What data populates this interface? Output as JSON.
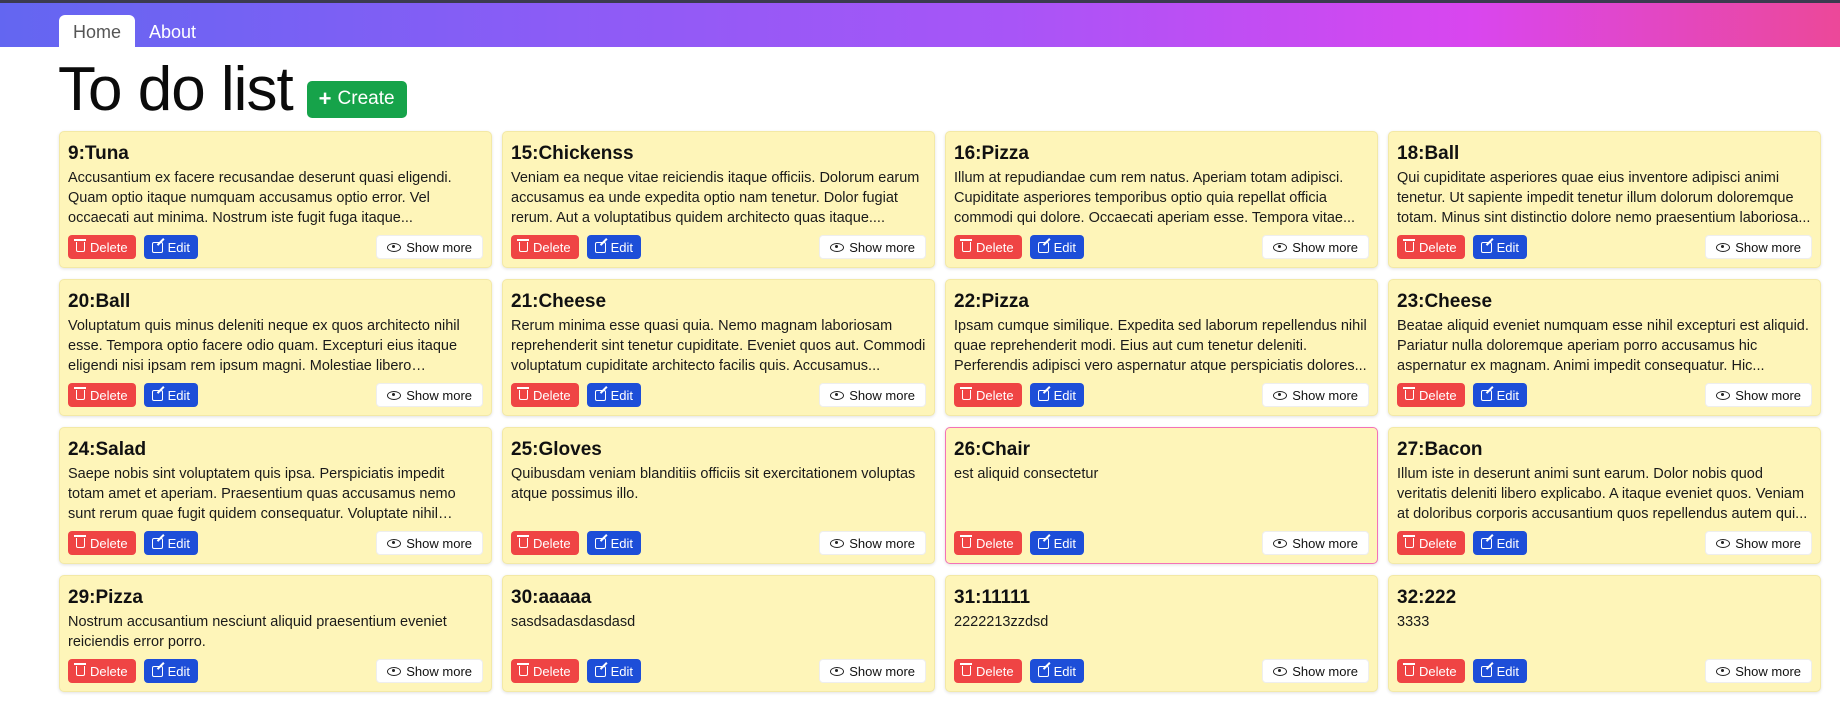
{
  "nav": {
    "tabs": [
      "Home",
      "About"
    ]
  },
  "header": {
    "title": "To do list",
    "create_label": "Create"
  },
  "actions": {
    "delete_label": "Delete",
    "edit_label": "Edit",
    "show_label": "Show more"
  },
  "cards": [
    {
      "title": "9:Tuna",
      "body": "Accusantium ex facere recusandae deserunt quasi eligendi. Quam optio itaque numquam accusamus optio error. Vel occaecati aut minima. Nostrum iste fugit fuga itaque..."
    },
    {
      "title": "15:Chickenss",
      "body": "Veniam ea neque vitae reiciendis itaque officiis. Dolorum earum accusamus ea unde expedita optio nam tenetur. Dolor fugiat rerum. Aut a voluptatibus quidem architecto quas itaque...."
    },
    {
      "title": "16:Pizza",
      "body": "Illum at repudiandae cum rem natus. Aperiam totam adipisci. Cupiditate asperiores temporibus optio quia repellat officia commodi qui dolore. Occaecati aperiam esse. Tempora vitae..."
    },
    {
      "title": "18:Ball",
      "body": "Qui cupiditate asperiores quae eius inventore adipisci animi tenetur. Ut sapiente impedit tenetur illum dolorum doloremque totam. Minus sint distinctio dolore nemo praesentium laboriosa..."
    },
    {
      "title": "20:Ball",
      "body": "Voluptatum quis minus deleniti neque ex quos architecto nihil esse. Tempora optio facere odio quam. Excepturi eius itaque eligendi nisi ipsam rem ipsum magni. Molestiae libero deserunt..."
    },
    {
      "title": "21:Cheese",
      "body": "Rerum minima esse quasi quia. Nemo magnam laboriosam reprehenderit sint tenetur cupiditate. Eveniet quos aut. Commodi voluptatum cupiditate architecto facilis quis. Accusamus..."
    },
    {
      "title": "22:Pizza",
      "body": "Ipsam cumque similique. Expedita sed laborum repellendus nihil quae reprehenderit modi. Eius aut cum tenetur deleniti. Perferendis adipisci vero aspernatur atque perspiciatis dolores..."
    },
    {
      "title": "23:Cheese",
      "body": "Beatae aliquid eveniet numquam esse nihil excepturi est aliquid. Pariatur nulla doloremque aperiam porro accusamus hic aspernatur ex magnam. Animi impedit consequatur. Hic..."
    },
    {
      "title": "24:Salad",
      "body": "Saepe nobis sint voluptatem quis ipsa. Perspiciatis impedit totam amet et aperiam. Praesentium quas accusamus nemo sunt rerum quae fugit quidem consequatur. Voluptate nihil quisquam..."
    },
    {
      "title": "25:Gloves",
      "body": "Quibusdam veniam blanditiis officiis sit exercitationem voluptas atque possimus illo."
    },
    {
      "title": "26:Chair",
      "body": "est aliquid consectetur",
      "highlight": true
    },
    {
      "title": "27:Bacon",
      "body": "Illum iste in deserunt animi sunt earum. Dolor nobis quod veritatis deleniti libero explicabo. A itaque eveniet quos. Veniam at doloribus corporis accusantium quos repellendus autem qui..."
    },
    {
      "title": "29:Pizza",
      "body": "Nostrum accusantium nesciunt aliquid praesentium eveniet reiciendis error porro."
    },
    {
      "title": "30:aaaaa",
      "body": "sasdsadasdasdasd"
    },
    {
      "title": "31:11111",
      "body": "2222213zzdsd"
    },
    {
      "title": "32:222",
      "body": "3333"
    }
  ]
}
